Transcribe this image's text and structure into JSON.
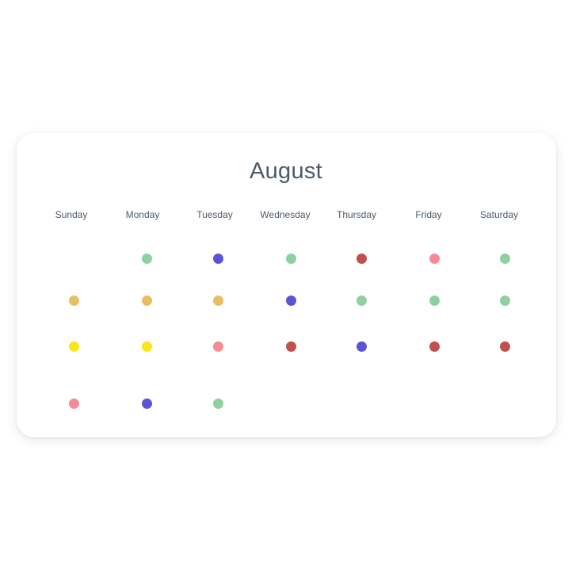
{
  "calendar": {
    "month": "August",
    "weekdays": [
      "Sunday",
      "Monday",
      "Tuesday",
      "Wednesday",
      "Thursday",
      "Friday",
      "Saturday"
    ]
  },
  "colors": {
    "green": "#8fd19e",
    "blue": "#5b55d6",
    "red": "#c0504d",
    "pink": "#f58b95",
    "orange": "#e9be63",
    "yellow": "#f8e61b"
  },
  "weeks": [
    [
      null,
      "green",
      "blue",
      "green",
      "red",
      "pink",
      "green"
    ],
    [
      "orange",
      "orange",
      "orange",
      "blue",
      "green",
      "green",
      "green"
    ],
    [
      "yellow",
      "yellow",
      "pink",
      "red",
      "blue",
      "red",
      "red"
    ],
    [
      "pink",
      "blue",
      "green",
      null,
      null,
      null,
      null
    ]
  ]
}
